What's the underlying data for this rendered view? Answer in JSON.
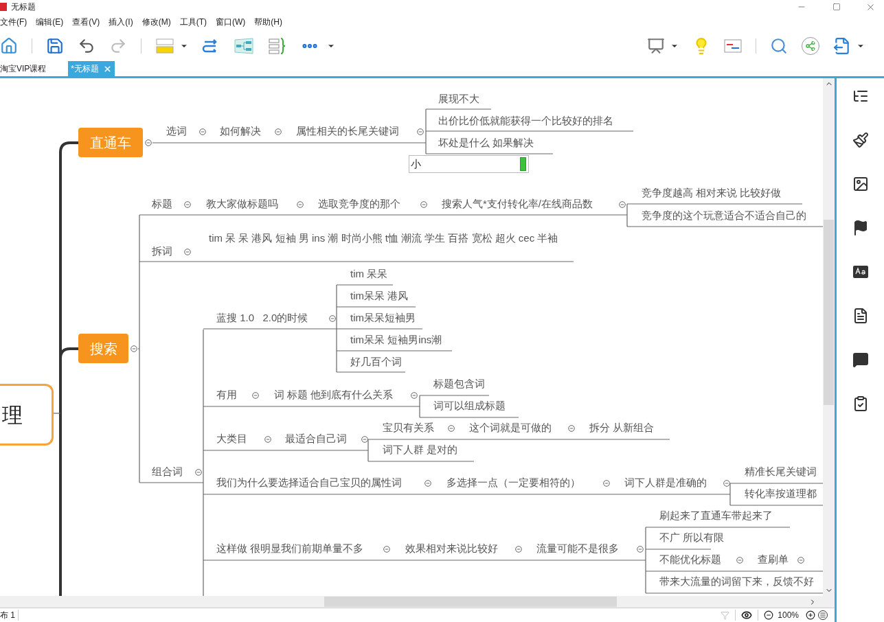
{
  "window": {
    "title": "无标题"
  },
  "menu": [
    "文件(F)",
    "编辑(E)",
    "查看(V)",
    "插入(I)",
    "修改(M)",
    "工具(T)",
    "窗口(W)",
    "帮助(H)"
  ],
  "tabs": [
    {
      "label": "淘宝VIP课程",
      "selected": false
    },
    {
      "label": "*无标题",
      "selected": true
    }
  ],
  "mindmap": {
    "root": {
      "text": "理",
      "kind": "central",
      "children": [
        {
          "text": "直通车",
          "kind": "main",
          "expanded": true,
          "children": [
            {
              "text": "选词",
              "expanded": true,
              "children": [
                {
                  "text": "如何解决",
                  "expanded": true,
                  "children": [
                    {
                      "text": "属性相关的长尾关键词",
                      "expanded": true,
                      "children": [
                        {
                          "text": "展现不大"
                        },
                        {
                          "text": "出价比价低就能获得一个比较好的排名"
                        },
                        {
                          "text": "坏处是什么 如果解决"
                        },
                        {
                          "kind": "input",
                          "value": "小"
                        }
                      ]
                    }
                  ]
                }
              ]
            }
          ]
        },
        {
          "text": "搜索",
          "kind": "main",
          "expanded": true,
          "children": [
            {
              "text": "标题",
              "expanded": true,
              "children": [
                {
                  "text": "教大家做标题吗",
                  "expanded": true,
                  "children": [
                    {
                      "text": "选取竞争度的那个",
                      "expanded": true,
                      "children": [
                        {
                          "text": "搜索人气*支付转化率/在线商品数",
                          "expanded": true,
                          "children": [
                            {
                              "text": "竞争度越高 相对来说 比较好做"
                            },
                            {
                              "text": "竞争度的这个玩意适合不适合自己的"
                            }
                          ]
                        }
                      ]
                    }
                  ]
                }
              ]
            },
            {
              "text": "拆词",
              "expanded": true,
              "children": [
                {
                  "text": "tim 呆 呆 港风 短袖 男 ins 潮 时尚小熊 t恤 潮流 学生 百搭 宽松 超火 cec 半袖"
                }
              ]
            },
            {
              "text": "组合词",
              "expanded": true,
              "children": [
                {
                  "text": "蓝搜 1.0   2.0的时候",
                  "expanded": true,
                  "children": [
                    {
                      "text": "tim 呆呆"
                    },
                    {
                      "text": "tim呆呆 港风"
                    },
                    {
                      "text": "tim呆呆短袖男"
                    },
                    {
                      "text": "tim呆呆 短袖男ins潮"
                    },
                    {
                      "text": "好几百个词"
                    }
                  ]
                },
                {
                  "text": "有用",
                  "expanded": true,
                  "children": [
                    {
                      "text": "词 标题 他到底有什么关系",
                      "expanded": true,
                      "children": [
                        {
                          "text": "标题包含词"
                        },
                        {
                          "text": "词可以组成标题"
                        }
                      ]
                    }
                  ]
                },
                {
                  "text": "大类目",
                  "expanded": true,
                  "children": [
                    {
                      "text": "最适合自己词",
                      "expanded": true,
                      "children": [
                        {
                          "text": "宝贝有关系",
                          "expanded": true,
                          "children": [
                            {
                              "text": "这个词就是可做的",
                              "expanded": true,
                              "children": [
                                {
                                  "text": "拆分 从新组合"
                                }
                              ]
                            }
                          ]
                        },
                        {
                          "text": "词下人群 是对的"
                        }
                      ]
                    }
                  ]
                },
                {
                  "text": "我们为什么要选择适合自己宝贝的属性词",
                  "expanded": true,
                  "children": [
                    {
                      "text": "多选择一点（一定要相符的）",
                      "expanded": true,
                      "children": [
                        {
                          "text": "词下人群是准确的",
                          "expanded": true,
                          "children": [
                            {
                              "text": "精准长尾关键词"
                            },
                            {
                              "text": "转化率按道理都"
                            }
                          ]
                        }
                      ]
                    }
                  ]
                },
                {
                  "text": "这样做 很明显我们前期单量不多",
                  "expanded": true,
                  "children": [
                    {
                      "text": "效果相对来说比较好",
                      "expanded": true,
                      "children": [
                        {
                          "text": "流量可能不是很多",
                          "expanded": true,
                          "children": [
                            {
                              "text": "刷起来了直通车带起来了"
                            },
                            {
                              "text": "不广 所以有限"
                            },
                            {
                              "text": "不能优化标题",
                              "expanded": true,
                              "children": [
                                {
                                  "text": "查刷单",
                                  "expanded": true
                                }
                              ]
                            },
                            {
                              "text": "带来大流量的词留下来，反馈不好"
                            }
                          ]
                        }
                      ]
                    }
                  ]
                }
              ]
            }
          ]
        }
      ]
    }
  },
  "status_bar": {
    "sheet": "布 1",
    "zoom": "100%"
  }
}
